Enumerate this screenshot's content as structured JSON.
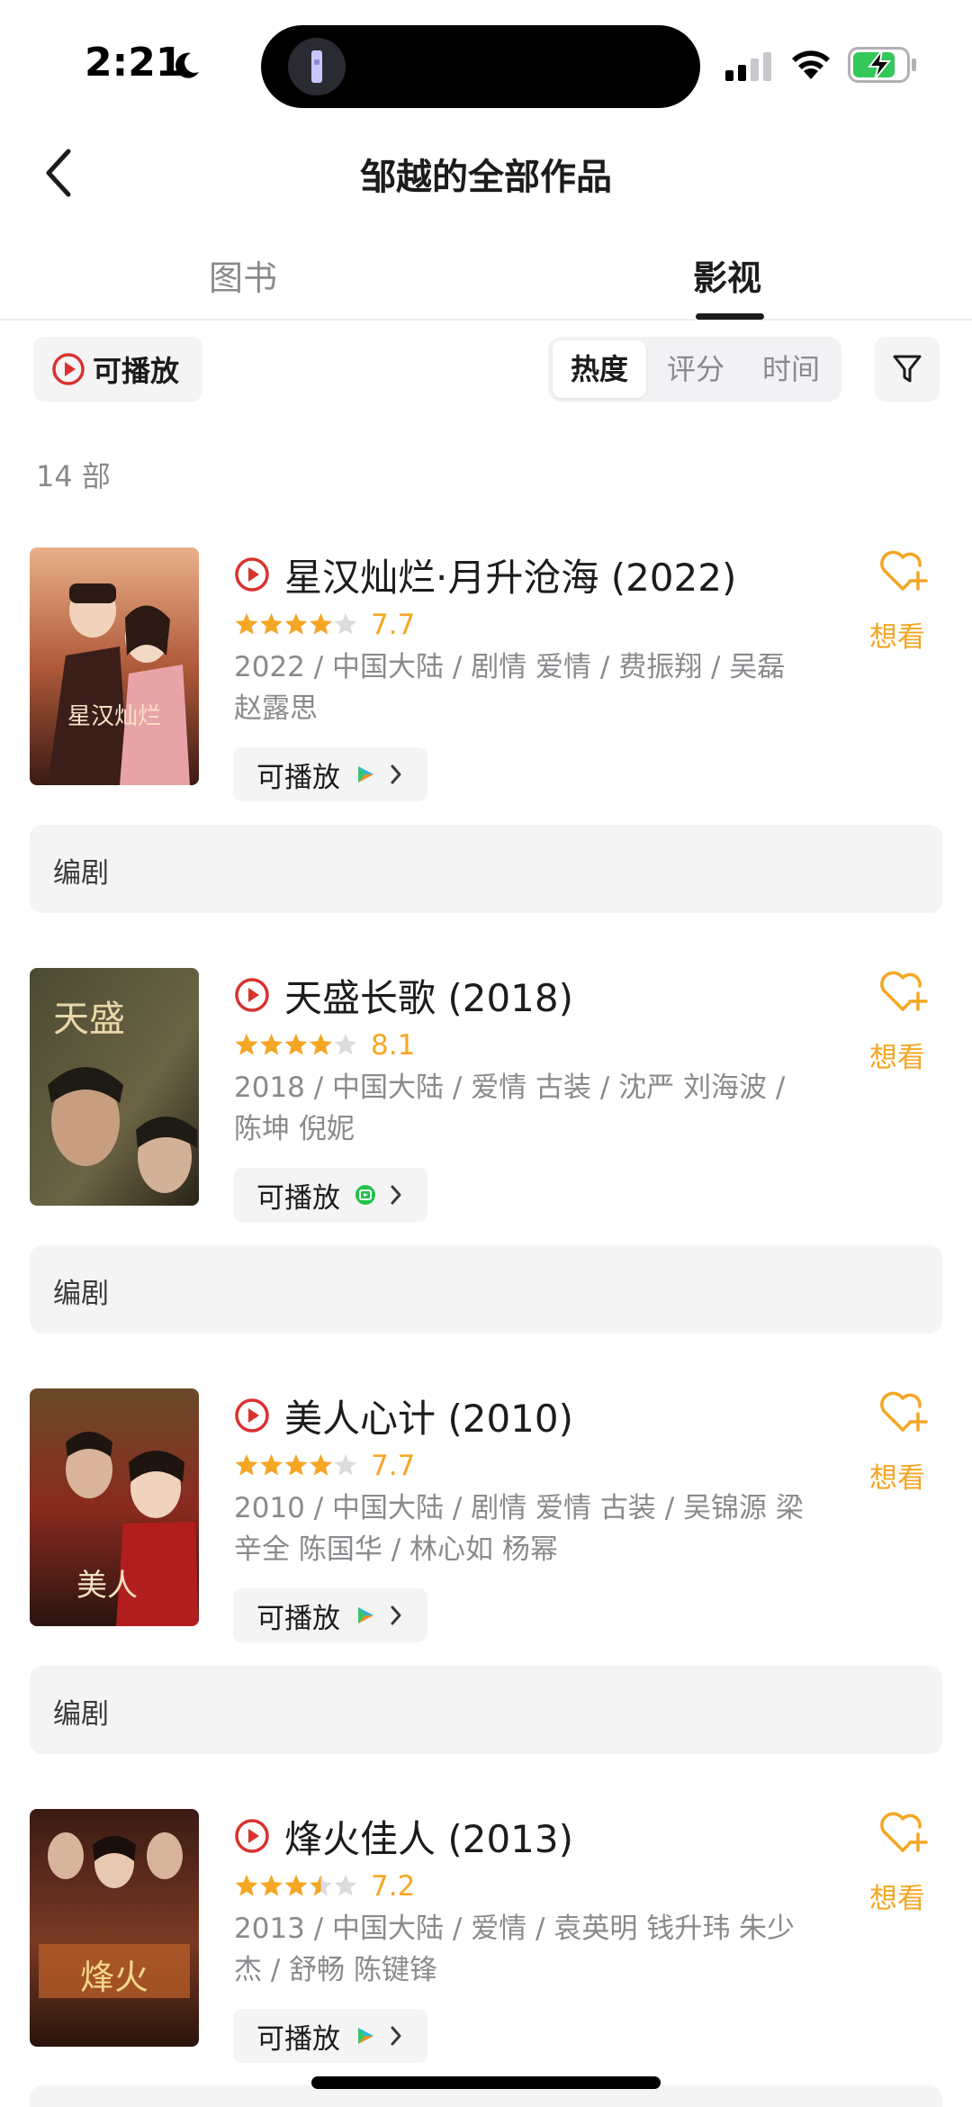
{
  "status_bar": {
    "time": "2:21"
  },
  "nav": {
    "title": "邹越的全部作品"
  },
  "tabs": [
    {
      "label": "图书",
      "active": false
    },
    {
      "label": "影视",
      "active": true
    }
  ],
  "filters": {
    "playable_label": "可播放",
    "sort_options": [
      {
        "label": "热度",
        "active": true
      },
      {
        "label": "评分",
        "active": false
      },
      {
        "label": "时间",
        "active": false
      }
    ]
  },
  "count_label": "14 部",
  "items": [
    {
      "title": "星汉灿烂·月升沧海 (2022)",
      "stars": 4,
      "rating": "7.7",
      "meta": "2022 / 中国大陆 / 剧情 爱情 / 费振翔 / 吴磊 赵露思",
      "watch_label": "可播放",
      "platform": "video-platform-icon",
      "want_label": "想看",
      "role": "编剧"
    },
    {
      "title": "天盛长歌 (2018)",
      "stars": 4,
      "rating": "8.1",
      "meta": "2018 / 中国大陆 / 爱情 古装 / 沈严 刘海波 / 陈坤 倪妮",
      "watch_label": "可播放",
      "platform": "iqiyi-icon",
      "want_label": "想看",
      "role": "编剧"
    },
    {
      "title": "美人心计 (2010)",
      "stars": 4,
      "rating": "7.7",
      "meta": "2010 / 中国大陆 / 剧情 爱情 古装 / 吴锦源 梁辛全 陈国华 / 林心如 杨幂",
      "watch_label": "可播放",
      "platform": "video-platform-icon",
      "want_label": "想看",
      "role": "编剧"
    },
    {
      "title": "烽火佳人 (2013)",
      "stars": 3.5,
      "rating": "7.2",
      "meta": "2013 / 中国大陆 / 爱情 / 袁英明 钱升玮 朱少杰 / 舒畅 陈键锋",
      "watch_label": "可播放",
      "platform": "video-platform-icon",
      "want_label": "想看",
      "role": ""
    }
  ],
  "colors": {
    "accent_orange": "#f5a623",
    "play_red": "#d9322e",
    "chip_bg": "#f4f4f5",
    "muted_text": "#8a8a8e"
  }
}
